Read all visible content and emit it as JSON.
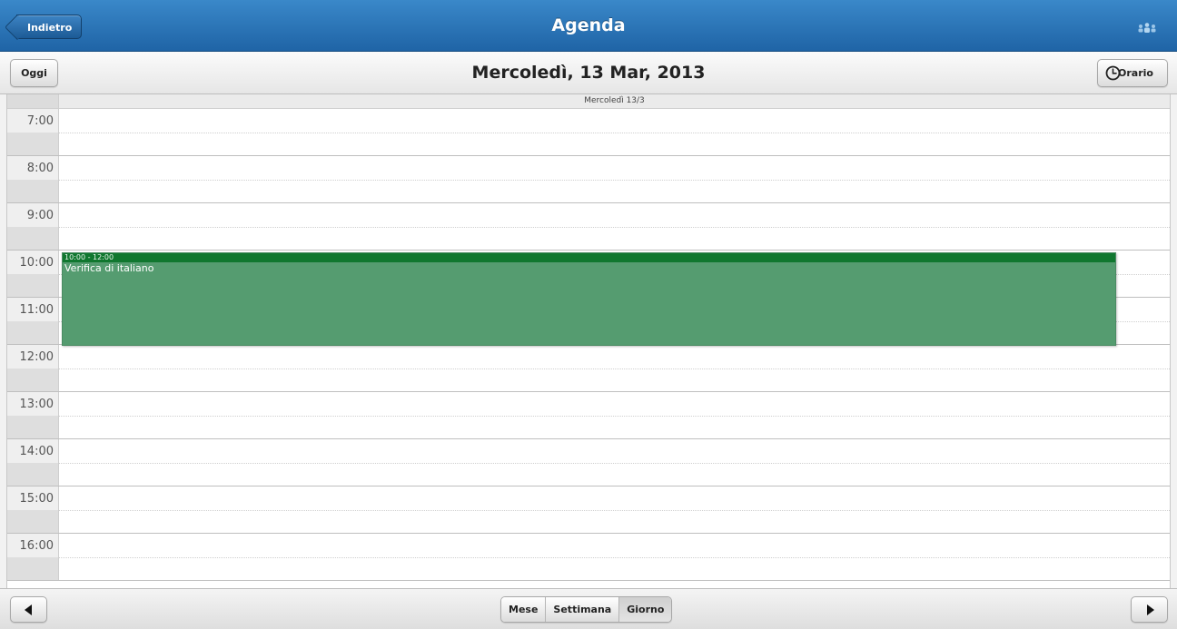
{
  "header": {
    "back_label": "Indietro",
    "title": "Agenda",
    "users_icon": "users-icon"
  },
  "toolbar": {
    "today_label": "Oggi",
    "current_date": "Mercoledì, 13 Mar, 2013",
    "schedule_label": "Orario",
    "schedule_icon": "clock-icon"
  },
  "day_view": {
    "day_label": "Mercoledì 13/3",
    "hours": [
      "7:00",
      "8:00",
      "9:00",
      "10:00",
      "11:00",
      "12:00",
      "13:00",
      "14:00",
      "15:00",
      "16:00"
    ],
    "event": {
      "time": "10:00 - 12:00",
      "title": "Verifica di italiano",
      "color": "#559c70",
      "header_color": "#10772f"
    }
  },
  "bottom": {
    "views": [
      "Mese",
      "Settimana",
      "Giorno"
    ],
    "active_view": "Giorno",
    "prev_icon": "triangle-left-icon",
    "next_icon": "triangle-right-icon"
  },
  "colors": {
    "header_blue": "#2a74b8",
    "event_green": "#559c70"
  }
}
